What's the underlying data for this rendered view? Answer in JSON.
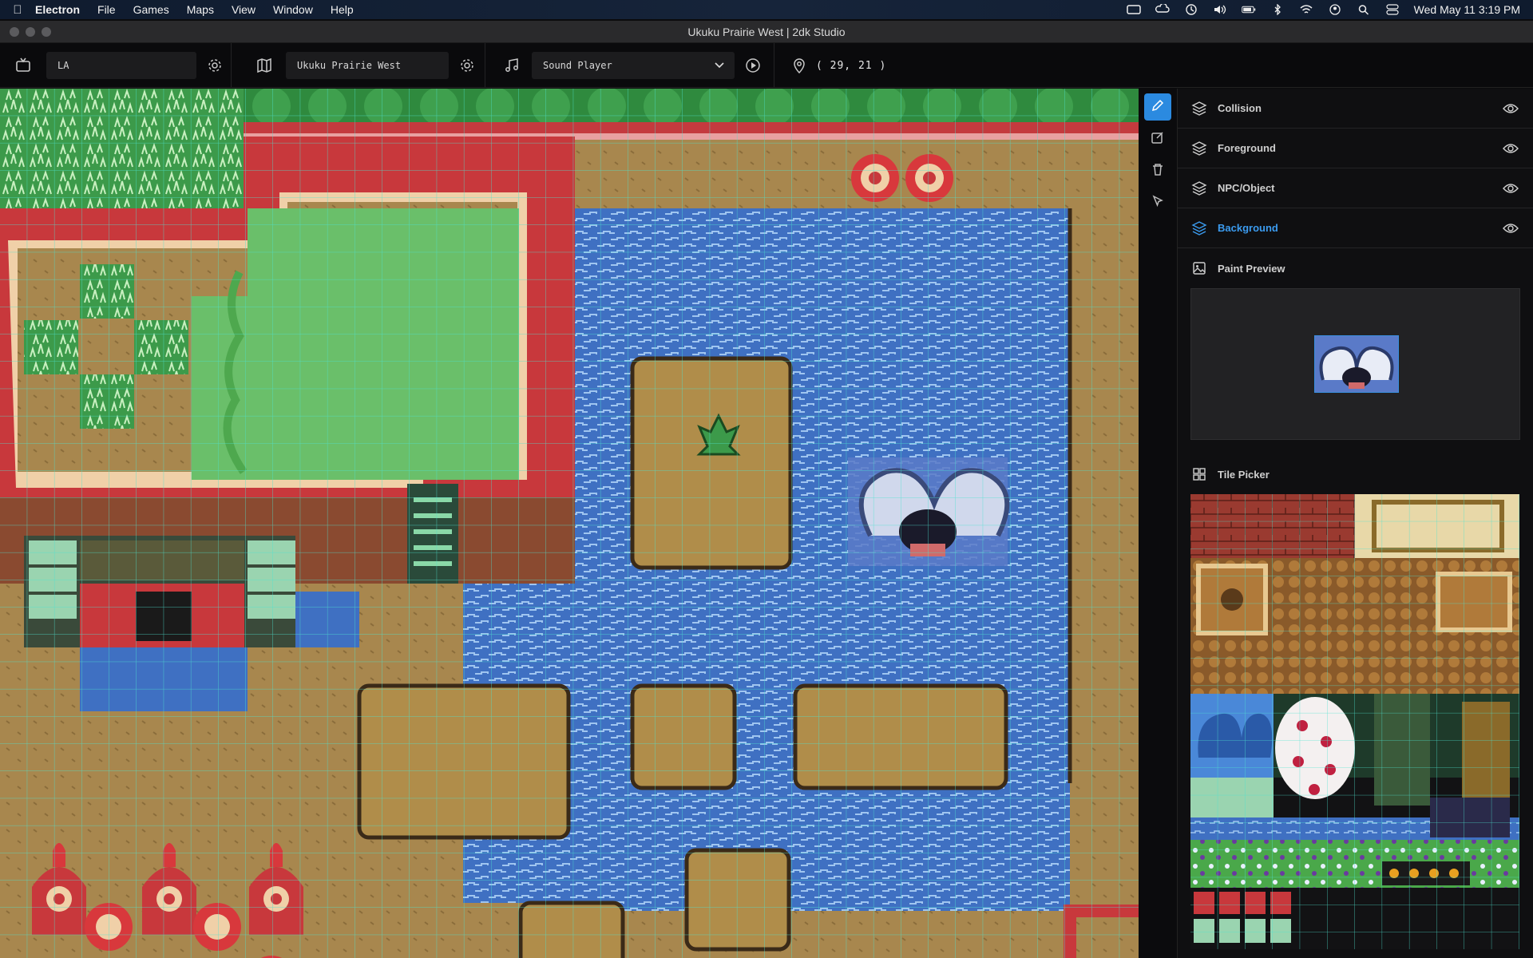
{
  "menubar": {
    "app": "Electron",
    "items": [
      "File",
      "Games",
      "Maps",
      "View",
      "Window",
      "Help"
    ],
    "clock": "Wed May 11  3:19 PM"
  },
  "window": {
    "title": "Ukuku Prairie West | 2dk Studio"
  },
  "toolbar": {
    "game_value": "LA",
    "map_value": "Ukuku Prairie West",
    "sound_value": "Sound Player",
    "coordinates": "( 29, 21 )"
  },
  "layers": [
    {
      "label": "Collision",
      "active": false
    },
    {
      "label": "Foreground",
      "active": false
    },
    {
      "label": "NPC/Object",
      "active": false
    },
    {
      "label": "Background",
      "active": true
    }
  ],
  "paint_preview": {
    "title": "Paint Preview"
  },
  "tile_picker": {
    "title": "Tile Picker"
  },
  "colors": {
    "accent": "#2b8ae0",
    "grid": "#4de3d0",
    "water": "#3c6fc0",
    "sand": "#a8874e",
    "grass": "#6abf6a",
    "cliff": "#c8383c"
  },
  "icons": {
    "game": "tv-icon",
    "map": "map-icon",
    "sound": "music-note-icon",
    "play": "play-circle-icon",
    "location": "map-pin-icon",
    "settings": "gear-icon",
    "dropdown": "chevron-down-icon",
    "tools": [
      "pencil-icon",
      "edit-square-icon",
      "trash-icon",
      "cursor-icon"
    ],
    "layer": "layers-icon",
    "visibility": "eye-icon",
    "preview": "image-icon",
    "picker": "grid-icon"
  }
}
